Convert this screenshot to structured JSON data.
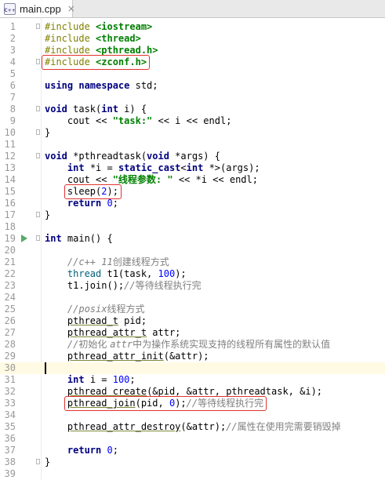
{
  "tab": {
    "label": "main.cpp",
    "icon": "cpp-file-icon",
    "icon_text": "C++"
  },
  "lines": [
    {
      "n": "1",
      "segs": [
        {
          "t": "#include ",
          "c": "pp"
        },
        {
          "t": "<iostream>",
          "c": "hd"
        }
      ]
    },
    {
      "n": "2",
      "segs": [
        {
          "t": "#include ",
          "c": "pp"
        },
        {
          "t": "<thread>",
          "c": "hd"
        }
      ]
    },
    {
      "n": "3",
      "segs": [
        {
          "t": "#include ",
          "c": "pp"
        },
        {
          "t": "<pthread.h>",
          "c": "hd"
        }
      ]
    },
    {
      "n": "4",
      "segs": [
        {
          "t": "#include ",
          "c": "pp"
        },
        {
          "t": "<zconf.h>",
          "c": "hd"
        }
      ]
    },
    {
      "n": "5",
      "segs": []
    },
    {
      "n": "6",
      "segs": [
        {
          "t": "using namespace ",
          "c": "kw"
        },
        {
          "t": "std;",
          "c": ""
        }
      ]
    },
    {
      "n": "7",
      "segs": []
    },
    {
      "n": "8",
      "segs": [
        {
          "t": "void ",
          "c": "kw"
        },
        {
          "t": "task(",
          "c": ""
        },
        {
          "t": "int ",
          "c": "kw"
        },
        {
          "t": "i) {",
          "c": ""
        }
      ]
    },
    {
      "n": "9",
      "segs": [
        {
          "t": "    cout << ",
          "c": ""
        },
        {
          "t": "\"task:\"",
          "c": "str"
        },
        {
          "t": " << i << endl;",
          "c": ""
        }
      ]
    },
    {
      "n": "10",
      "segs": [
        {
          "t": "}",
          "c": ""
        }
      ]
    },
    {
      "n": "11",
      "segs": []
    },
    {
      "n": "12",
      "segs": [
        {
          "t": "void ",
          "c": "kw"
        },
        {
          "t": "*pthreadtask(",
          "c": ""
        },
        {
          "t": "void ",
          "c": "kw"
        },
        {
          "t": "*args) {",
          "c": ""
        }
      ]
    },
    {
      "n": "13",
      "segs": [
        {
          "t": "    ",
          "c": ""
        },
        {
          "t": "int ",
          "c": "kw"
        },
        {
          "t": "*i = ",
          "c": ""
        },
        {
          "t": "static_cast",
          "c": "kw"
        },
        {
          "t": "<",
          "c": ""
        },
        {
          "t": "int ",
          "c": "kw"
        },
        {
          "t": "*>(args);",
          "c": ""
        }
      ]
    },
    {
      "n": "14",
      "segs": [
        {
          "t": "    cout << ",
          "c": ""
        },
        {
          "t": "\"线程参数: \"",
          "c": "str"
        },
        {
          "t": " << *i << endl;",
          "c": ""
        }
      ]
    },
    {
      "n": "15",
      "segs": [
        {
          "t": "    sleep(",
          "c": ""
        },
        {
          "t": "2",
          "c": "num"
        },
        {
          "t": ");",
          "c": ""
        }
      ]
    },
    {
      "n": "16",
      "segs": [
        {
          "t": "    ",
          "c": ""
        },
        {
          "t": "return ",
          "c": "kw"
        },
        {
          "t": "0",
          "c": "num"
        },
        {
          "t": ";",
          "c": ""
        }
      ]
    },
    {
      "n": "17",
      "segs": [
        {
          "t": "}",
          "c": ""
        }
      ]
    },
    {
      "n": "18",
      "segs": []
    },
    {
      "n": "19",
      "segs": [
        {
          "t": "int ",
          "c": "kw"
        },
        {
          "t": "main() {",
          "c": ""
        }
      ]
    },
    {
      "n": "20",
      "segs": []
    },
    {
      "n": "21",
      "segs": [
        {
          "t": "    ",
          "c": ""
        },
        {
          "t": "//c++ 11",
          "c": "cm"
        },
        {
          "t": "创建线程方式",
          "c": "cmz"
        }
      ]
    },
    {
      "n": "22",
      "segs": [
        {
          "t": "    ",
          "c": ""
        },
        {
          "t": "thread ",
          "c": "fn"
        },
        {
          "t": "t1(task, ",
          "c": ""
        },
        {
          "t": "100",
          "c": "num"
        },
        {
          "t": ");",
          "c": ""
        }
      ]
    },
    {
      "n": "23",
      "segs": [
        {
          "t": "    t1.join();",
          "c": ""
        },
        {
          "t": "//",
          "c": "cm"
        },
        {
          "t": "等待线程执行完",
          "c": "cmz"
        }
      ]
    },
    {
      "n": "24",
      "segs": []
    },
    {
      "n": "25",
      "segs": [
        {
          "t": "    ",
          "c": ""
        },
        {
          "t": "//posix",
          "c": "cm"
        },
        {
          "t": "线程方式",
          "c": "cmz"
        }
      ]
    },
    {
      "n": "26",
      "segs": [
        {
          "t": "    ",
          "c": ""
        },
        {
          "t": "pthread_t",
          "c": "ul"
        },
        {
          "t": " pid;",
          "c": ""
        }
      ]
    },
    {
      "n": "27",
      "segs": [
        {
          "t": "    ",
          "c": ""
        },
        {
          "t": "pthread_attr_t",
          "c": "ul"
        },
        {
          "t": " attr;",
          "c": ""
        }
      ]
    },
    {
      "n": "28",
      "segs": [
        {
          "t": "    ",
          "c": ""
        },
        {
          "t": "//",
          "c": "cm"
        },
        {
          "t": "初始化 ",
          "c": "cmz"
        },
        {
          "t": "attr",
          "c": "cm"
        },
        {
          "t": "中为操作系统实现支持的线程所有属性的默认值",
          "c": "cmz"
        }
      ]
    },
    {
      "n": "29",
      "segs": [
        {
          "t": "    ",
          "c": ""
        },
        {
          "t": "pthread_attr_init",
          "c": "ul"
        },
        {
          "t": "(&attr);",
          "c": ""
        }
      ]
    },
    {
      "n": "30",
      "segs": []
    },
    {
      "n": "31",
      "segs": [
        {
          "t": "    ",
          "c": ""
        },
        {
          "t": "int ",
          "c": "kw"
        },
        {
          "t": "i = ",
          "c": ""
        },
        {
          "t": "100",
          "c": "num"
        },
        {
          "t": ";",
          "c": ""
        }
      ]
    },
    {
      "n": "32",
      "segs": [
        {
          "t": "    ",
          "c": ""
        },
        {
          "t": "pthread_create",
          "c": "ul"
        },
        {
          "t": "(&pid, &attr, pthreadtask, &i);",
          "c": ""
        }
      ]
    },
    {
      "n": "33",
      "segs": [
        {
          "t": "    ",
          "c": ""
        },
        {
          "t": "pthread_join",
          "c": "ul"
        },
        {
          "t": "(pid, ",
          "c": ""
        },
        {
          "t": "0",
          "c": "num"
        },
        {
          "t": ");",
          "c": ""
        },
        {
          "t": "//",
          "c": "cm"
        },
        {
          "t": "等待线程执行完",
          "c": "cmz"
        }
      ]
    },
    {
      "n": "34",
      "segs": []
    },
    {
      "n": "35",
      "segs": [
        {
          "t": "    ",
          "c": ""
        },
        {
          "t": "pthread_attr_destroy",
          "c": "ul"
        },
        {
          "t": "(&attr);",
          "c": ""
        },
        {
          "t": "//",
          "c": "cm"
        },
        {
          "t": "属性在使用完需要销毁掉",
          "c": "cmz"
        }
      ]
    },
    {
      "n": "36",
      "segs": []
    },
    {
      "n": "37",
      "segs": [
        {
          "t": "    ",
          "c": ""
        },
        {
          "t": "return ",
          "c": "kw"
        },
        {
          "t": "0",
          "c": "num"
        },
        {
          "t": ";",
          "c": ""
        }
      ]
    },
    {
      "n": "38",
      "segs": [
        {
          "t": "}",
          "c": ""
        }
      ]
    },
    {
      "n": "39",
      "segs": []
    }
  ],
  "folds": [
    "1",
    "4",
    "8",
    "10",
    "12",
    "17",
    "19",
    "38"
  ],
  "run_line": "19",
  "caret_line": "30",
  "highlights": [
    "4",
    "15",
    "33"
  ],
  "colors": {
    "highlight": "#e0332e",
    "caret_line": "#fffae3",
    "run": "#59a869"
  }
}
